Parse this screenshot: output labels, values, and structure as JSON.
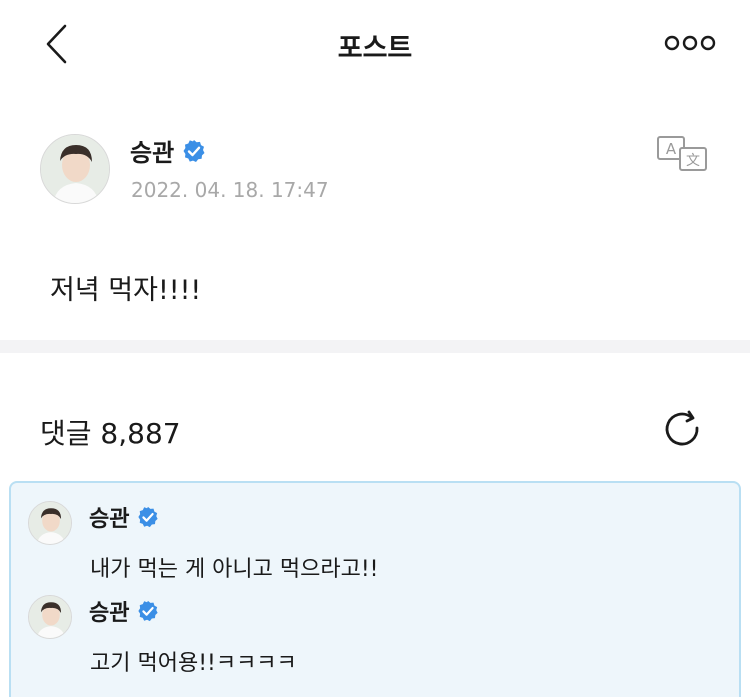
{
  "header": {
    "title": "포스트",
    "back_icon": "chevron-left-icon",
    "more_icon": "more-horizontal-icon"
  },
  "post": {
    "author": "승관",
    "verified_icon": "verified-badge-icon",
    "timestamp": "2022. 04. 18. 17:47",
    "body": "저녁 먹자!!!!",
    "translate_icon": "translate-icon"
  },
  "comments": {
    "label": "댓글 8,887",
    "refresh_icon": "refresh-icon",
    "items": [
      {
        "author": "승관",
        "text": "내가 먹는 게 아니고 먹으라고!!"
      },
      {
        "author": "승관",
        "text": "고기 먹어용!!ㅋㅋㅋㅋ"
      }
    ]
  },
  "colors": {
    "verified": "#3b8fe6",
    "timestamp": "#a8a8a8",
    "comment_bg": "#eef6fb",
    "comment_border": "#b9dff3",
    "divider": "#f3f3f5"
  }
}
